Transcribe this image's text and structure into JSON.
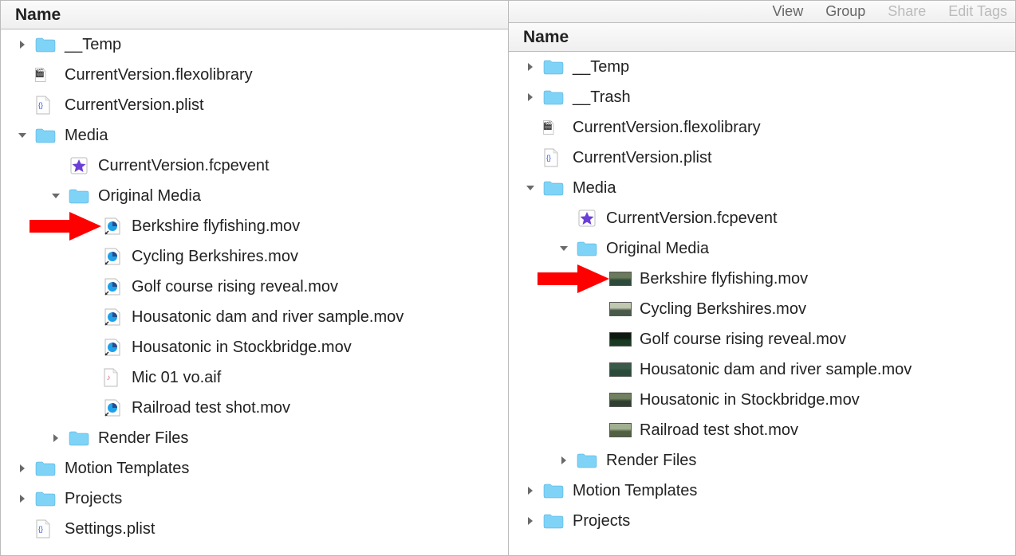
{
  "columns": {
    "name": "Name"
  },
  "toolbar": {
    "view": "View",
    "group": "Group",
    "share": "Share",
    "edit_tags": "Edit Tags"
  },
  "left": {
    "rows": [
      {
        "depth": 0,
        "disclosure": "right",
        "icon": "folder",
        "label": "__Temp"
      },
      {
        "depth": 0,
        "disclosure": "none",
        "icon": "doc-clapper",
        "label": "CurrentVersion.flexolibrary"
      },
      {
        "depth": 0,
        "disclosure": "none",
        "icon": "doc-plist",
        "label": "CurrentVersion.plist"
      },
      {
        "depth": 0,
        "disclosure": "down",
        "icon": "folder",
        "label": "Media"
      },
      {
        "depth": 1,
        "disclosure": "none",
        "icon": "star",
        "label": "CurrentVersion.fcpevent"
      },
      {
        "depth": 1,
        "disclosure": "down",
        "icon": "folder",
        "label": "Original Media"
      },
      {
        "depth": 2,
        "disclosure": "none",
        "icon": "qt-alias",
        "label": "Berkshire flyfishing.mov",
        "arrow": true
      },
      {
        "depth": 2,
        "disclosure": "none",
        "icon": "qt-alias",
        "label": "Cycling Berkshires.mov"
      },
      {
        "depth": 2,
        "disclosure": "none",
        "icon": "qt-alias",
        "label": "Golf course rising reveal.mov"
      },
      {
        "depth": 2,
        "disclosure": "none",
        "icon": "qt-alias",
        "label": "Housatonic dam and river sample.mov"
      },
      {
        "depth": 2,
        "disclosure": "none",
        "icon": "qt-alias",
        "label": "Housatonic in Stockbridge.mov"
      },
      {
        "depth": 2,
        "disclosure": "none",
        "icon": "doc-audio",
        "label": "Mic 01 vo.aif"
      },
      {
        "depth": 2,
        "disclosure": "none",
        "icon": "qt-alias",
        "label": "Railroad test shot.mov"
      },
      {
        "depth": 1,
        "disclosure": "right",
        "icon": "folder",
        "label": "Render Files"
      },
      {
        "depth": 0,
        "disclosure": "right",
        "icon": "folder",
        "label": "Motion Templates"
      },
      {
        "depth": 0,
        "disclosure": "right",
        "icon": "folder",
        "label": "Projects"
      },
      {
        "depth": 0,
        "disclosure": "none",
        "icon": "doc-plist",
        "label": "Settings.plist"
      }
    ]
  },
  "right": {
    "rows": [
      {
        "depth": 0,
        "disclosure": "right",
        "icon": "folder",
        "label": "__Temp"
      },
      {
        "depth": 0,
        "disclosure": "right",
        "icon": "folder",
        "label": "__Trash"
      },
      {
        "depth": 0,
        "disclosure": "none",
        "icon": "doc-clapper",
        "label": "CurrentVersion.flexolibrary"
      },
      {
        "depth": 0,
        "disclosure": "none",
        "icon": "doc-plist",
        "label": "CurrentVersion.plist"
      },
      {
        "depth": 0,
        "disclosure": "down",
        "icon": "folder",
        "label": "Media"
      },
      {
        "depth": 1,
        "disclosure": "none",
        "icon": "star",
        "label": "CurrentVersion.fcpevent"
      },
      {
        "depth": 1,
        "disclosure": "down",
        "icon": "folder",
        "label": "Original Media"
      },
      {
        "depth": 2,
        "disclosure": "none",
        "icon": "thumb",
        "thumb": "t1",
        "label": "Berkshire flyfishing.mov",
        "arrow": true
      },
      {
        "depth": 2,
        "disclosure": "none",
        "icon": "thumb",
        "thumb": "t2",
        "label": "Cycling Berkshires.mov"
      },
      {
        "depth": 2,
        "disclosure": "none",
        "icon": "thumb",
        "thumb": "t3",
        "label": "Golf course rising reveal.mov"
      },
      {
        "depth": 2,
        "disclosure": "none",
        "icon": "thumb",
        "thumb": "t4",
        "label": "Housatonic dam and river sample.mov"
      },
      {
        "depth": 2,
        "disclosure": "none",
        "icon": "thumb",
        "thumb": "t5",
        "label": "Housatonic in Stockbridge.mov"
      },
      {
        "depth": 2,
        "disclosure": "none",
        "icon": "thumb",
        "thumb": "t6",
        "label": "Railroad test shot.mov"
      },
      {
        "depth": 1,
        "disclosure": "right",
        "icon": "folder",
        "label": "Render Files"
      },
      {
        "depth": 0,
        "disclosure": "right",
        "icon": "folder",
        "label": "Motion Templates"
      },
      {
        "depth": 0,
        "disclosure": "right",
        "icon": "folder",
        "label": "Projects"
      }
    ]
  }
}
